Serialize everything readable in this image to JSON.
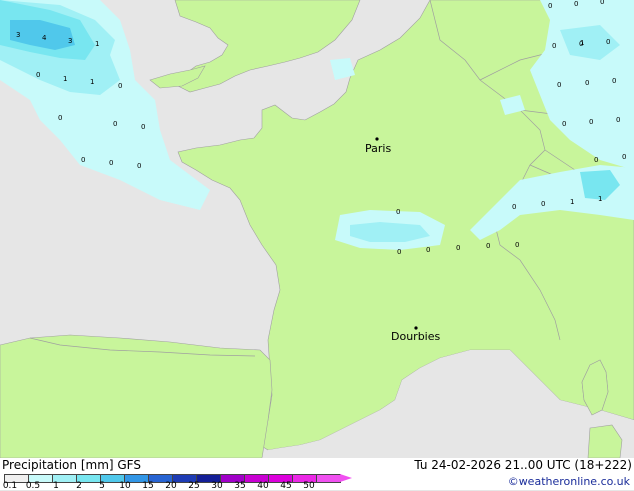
{
  "map": {
    "cities": [
      {
        "name": "Paris"
      },
      {
        "name": "Dourbies"
      }
    ],
    "values": [
      {
        "text": "3"
      },
      {
        "text": "4"
      },
      {
        "text": "3"
      },
      {
        "text": "1"
      },
      {
        "text": "0"
      },
      {
        "text": "1"
      },
      {
        "text": "1"
      },
      {
        "text": "0"
      },
      {
        "text": "0"
      },
      {
        "text": "0"
      },
      {
        "text": "0"
      },
      {
        "text": "0"
      },
      {
        "text": "0"
      },
      {
        "text": "0"
      },
      {
        "text": "0"
      },
      {
        "text": "0"
      },
      {
        "text": "0"
      },
      {
        "text": "0"
      },
      {
        "text": "0"
      },
      {
        "text": "0"
      },
      {
        "text": "0"
      },
      {
        "text": "0"
      },
      {
        "text": "0"
      },
      {
        "text": "1"
      },
      {
        "text": "0"
      },
      {
        "text": "0"
      },
      {
        "text": "0"
      },
      {
        "text": "0"
      },
      {
        "text": "0"
      },
      {
        "text": "0"
      },
      {
        "text": "0"
      },
      {
        "text": "0"
      },
      {
        "text": "0"
      },
      {
        "text": "0"
      },
      {
        "text": "1"
      },
      {
        "text": "1"
      }
    ],
    "colors": {
      "land": "#c8f59b",
      "sea": "#e6e6e6",
      "border": "#a0a0a0"
    }
  },
  "footer": {
    "title": "Precipitation [mm]  GFS",
    "datetime": "Tu 24-02-2026 21..00 UTC (18+222)",
    "credit": "©weatheronline.co.uk",
    "scale_labels": [
      "0.1",
      "0.5",
      "1",
      "2",
      "5",
      "10",
      "15",
      "20",
      "25",
      "30",
      "35",
      "40",
      "45",
      "50"
    ],
    "scale_colors": [
      "#f0f0f0",
      "#c8fafa",
      "#a0f0f5",
      "#78e6f0",
      "#50c8eb",
      "#3296e6",
      "#2864d2",
      "#1e3cb4",
      "#141e96",
      "#a000c8",
      "#c800d2",
      "#dc00dc",
      "#eb28e6",
      "#f050f0"
    ]
  }
}
